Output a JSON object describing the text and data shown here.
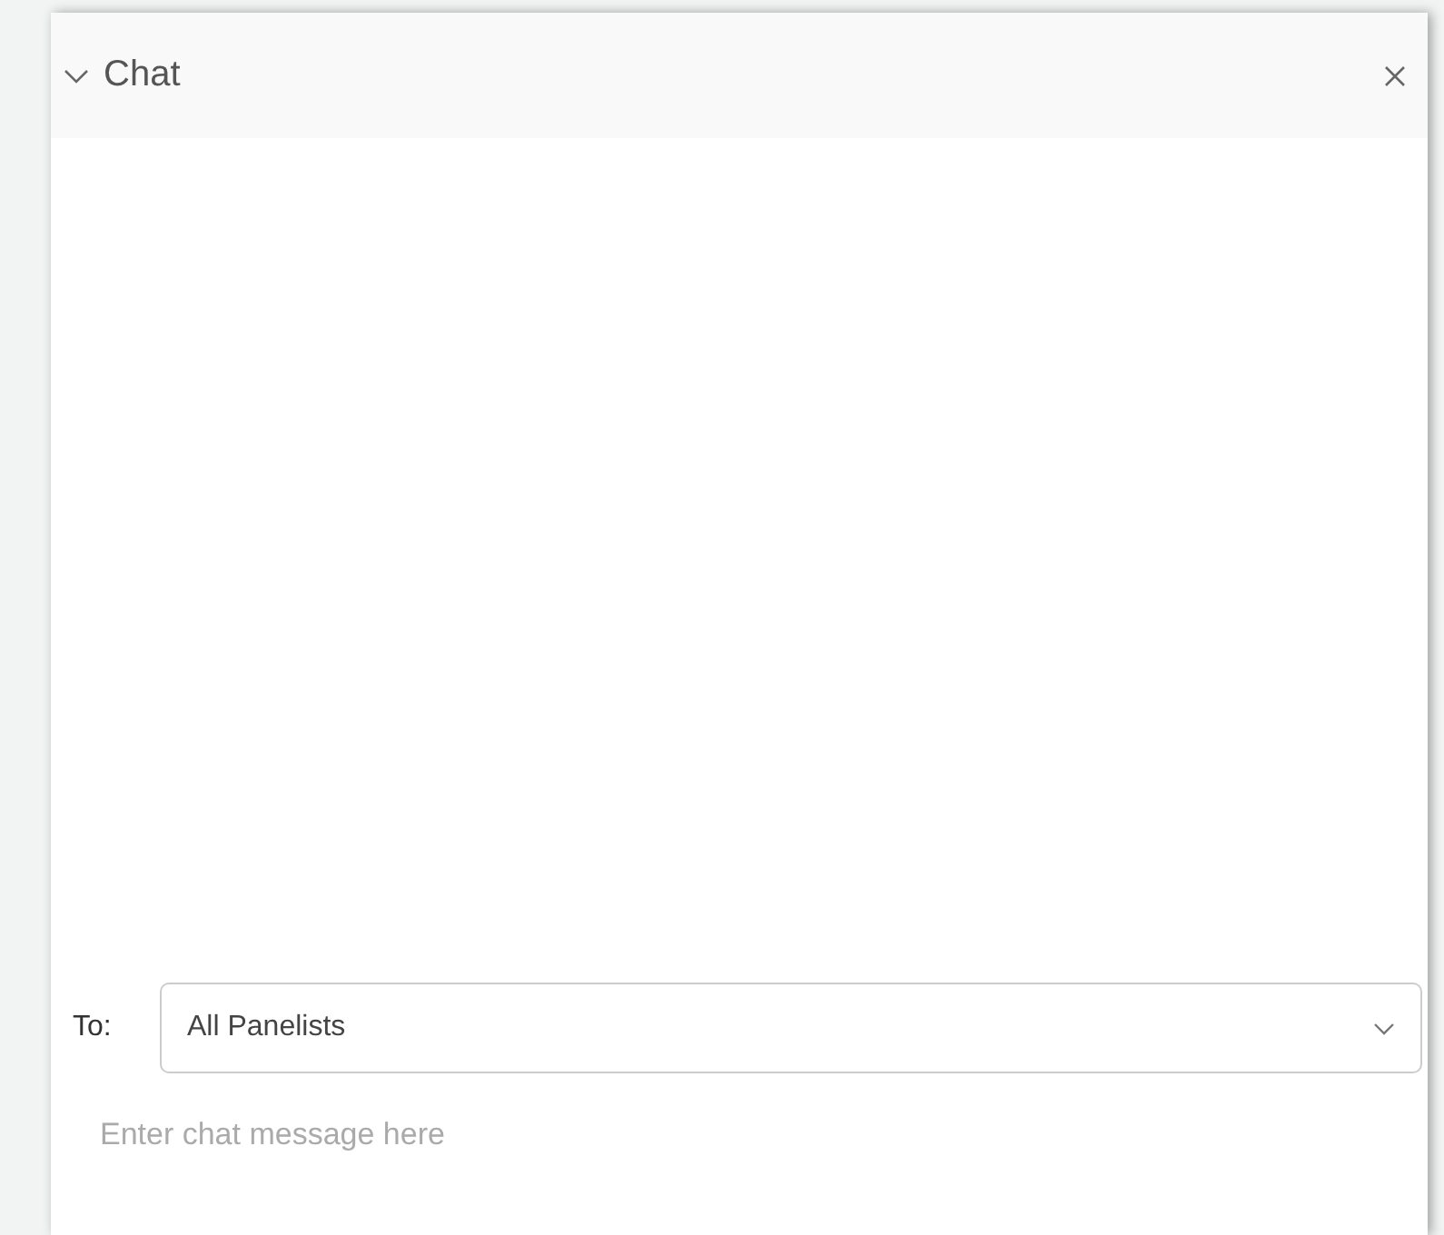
{
  "panel": {
    "title": "Chat",
    "expanded": true
  },
  "recipient": {
    "label": "To:",
    "value": "All Panelists"
  },
  "message": {
    "placeholder": "Enter chat message here"
  }
}
